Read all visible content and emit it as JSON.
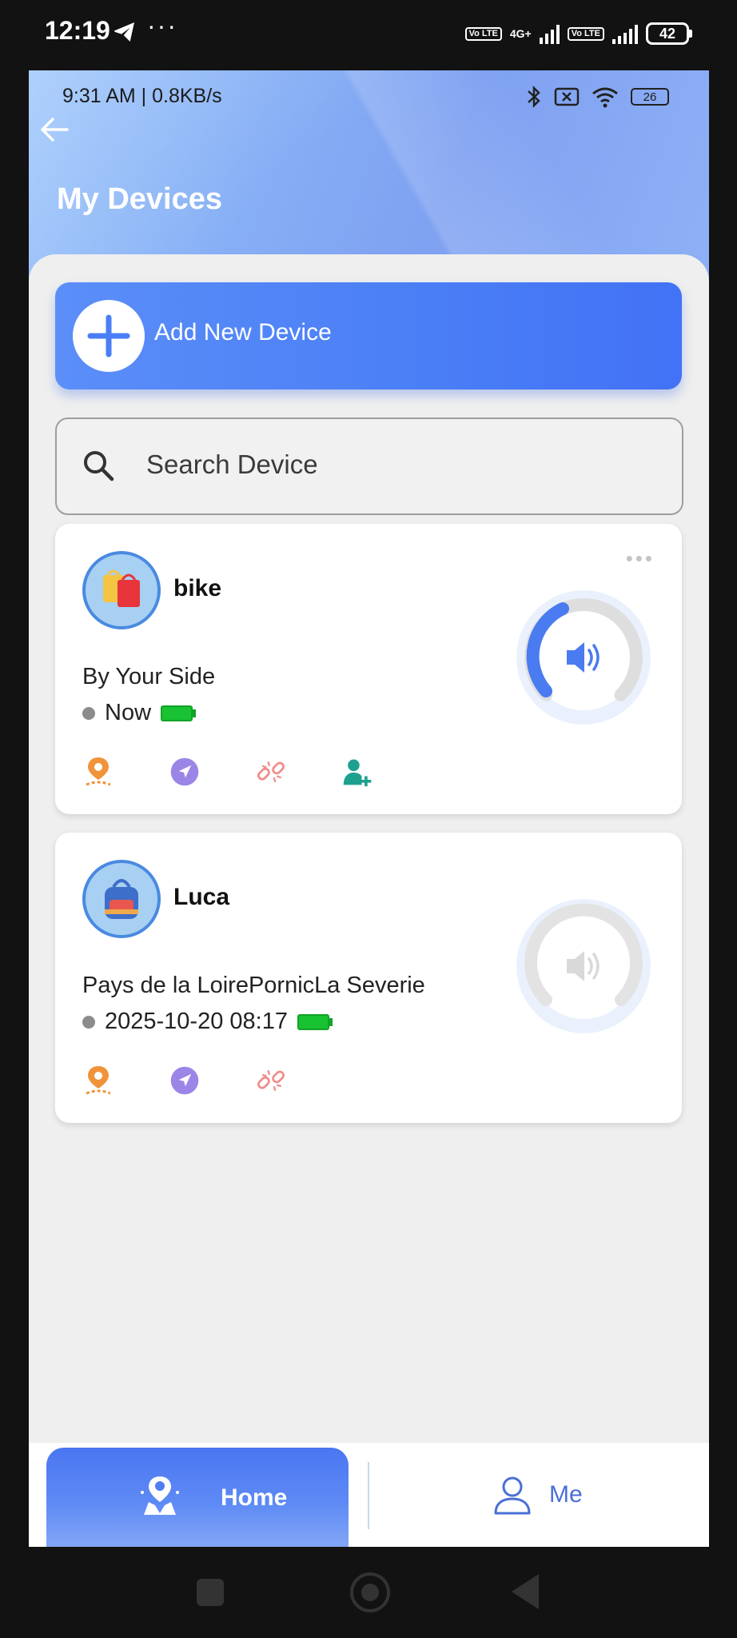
{
  "outer_status": {
    "time": "12:19",
    "dots": "···",
    "volte1": "Vo LTE",
    "network": "4G+",
    "volte2": "Vo LTE",
    "battery": "42"
  },
  "inner_status": {
    "left": "9:31 AM | 0.8KB/s",
    "battery": "26"
  },
  "header": {
    "title": "My Devices"
  },
  "add_device": {
    "label": "Add New Device"
  },
  "search": {
    "placeholder": "Search Device"
  },
  "devices": [
    {
      "name": "bike",
      "address": "By Your Side",
      "time": "Now",
      "more": "•••",
      "icons": [
        "location-pin-icon",
        "navigation-icon",
        "unlink-icon",
        "add-user-icon"
      ],
      "sound_active": true,
      "colors": {
        "ring_active": "#4a7bf0",
        "ring_track": "#dedede"
      }
    },
    {
      "name": "Luca",
      "address": "Pays de la LoirePornicLa Severie",
      "time": "2025-10-20 08:17",
      "icons": [
        "location-pin-icon",
        "navigation-icon",
        "unlink-icon"
      ],
      "sound_active": false
    }
  ],
  "bottom_nav": {
    "home": "Home",
    "me": "Me"
  },
  "colors": {
    "accent": "#4a7ef6",
    "battery_green": "#18c232",
    "hero": "#86aef5"
  }
}
